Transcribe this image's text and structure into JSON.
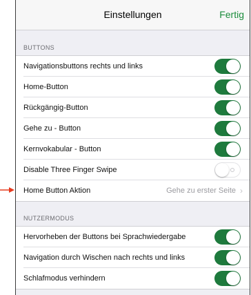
{
  "header": {
    "title": "Einstellungen",
    "done_label": "Fertig"
  },
  "sections": [
    {
      "title": "BUTTONS",
      "rows": [
        {
          "label": "Navigationsbuttons rechts und links",
          "toggle": true
        },
        {
          "label": "Home-Button",
          "toggle": true
        },
        {
          "label": "Rückgängig-Button",
          "toggle": true
        },
        {
          "label": "Gehe zu - Button",
          "toggle": true
        },
        {
          "label": "Kernvokabular - Button",
          "toggle": true
        },
        {
          "label": "Disable Three Finger Swipe",
          "toggle": false
        },
        {
          "label": "Home Button Aktion",
          "value": "Gehe zu erster Seite"
        }
      ]
    },
    {
      "title": "NUTZERMODUS",
      "rows": [
        {
          "label": "Hervorheben der Buttons bei Sprachwiedergabe",
          "toggle": true
        },
        {
          "label": "Navigation durch Wischen nach rechts und links",
          "toggle": true
        },
        {
          "label": "Schlafmodus verhindern",
          "toggle": true
        }
      ]
    }
  ],
  "colors": {
    "accent": "#1a8c3b",
    "toggle_on": "#1e7a3d",
    "pointer_arrow": "#e63a1e"
  },
  "icons": {
    "chevron": "chevron-right-icon",
    "pointer": "red-arrow-pointer-icon"
  }
}
